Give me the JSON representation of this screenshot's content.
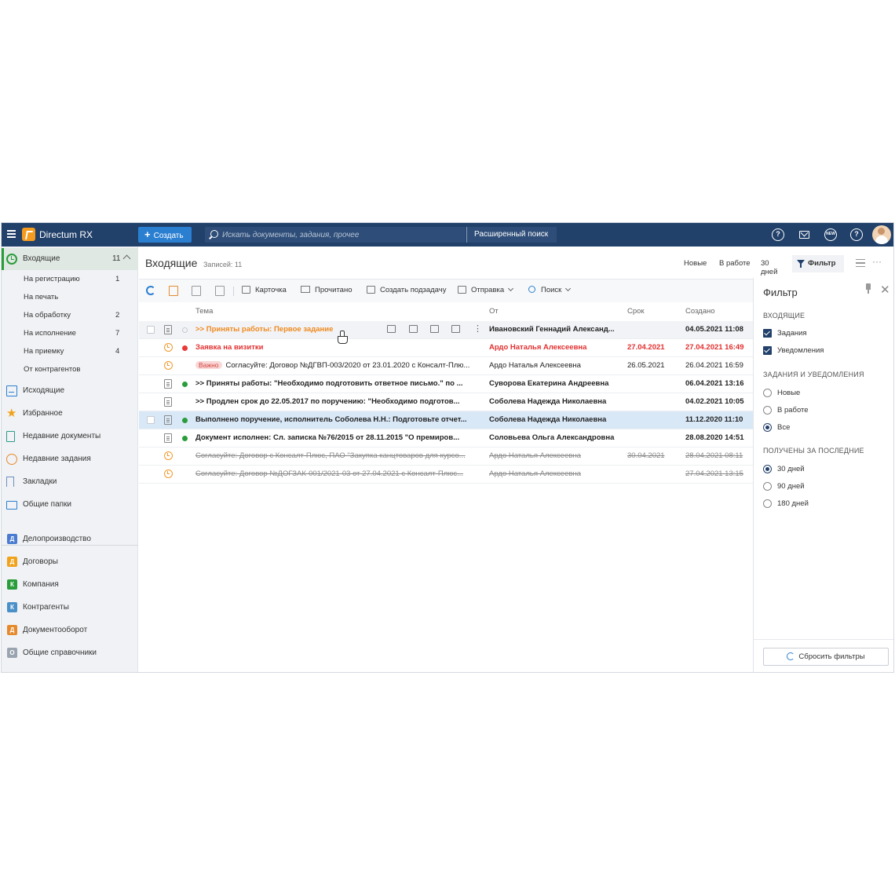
{
  "header": {
    "app_title": "Directum RX",
    "create_label": "Создать",
    "search_placeholder": "Искать документы, задания, прочее",
    "advanced_search": "Расширенный поиск",
    "icons": [
      "support-icon",
      "mail-icon",
      "new-icon",
      "help-icon"
    ],
    "new_badge": "NEW",
    "help_glyph": "?"
  },
  "sidebar": {
    "inbox": {
      "label": "Входящие",
      "count": "11"
    },
    "inbox_sub": [
      {
        "label": "На регистрацию",
        "count": "1"
      },
      {
        "label": "На печать",
        "count": ""
      },
      {
        "label": "На обработку",
        "count": "2"
      },
      {
        "label": "На исполнение",
        "count": "7"
      },
      {
        "label": "На приемку",
        "count": "4"
      },
      {
        "label": "От контрагентов",
        "count": ""
      }
    ],
    "items": [
      {
        "label": "Исходящие"
      },
      {
        "label": "Избранное"
      },
      {
        "label": "Недавние документы"
      },
      {
        "label": "Недавние задания"
      },
      {
        "label": "Закладки"
      },
      {
        "label": "Общие папки"
      }
    ],
    "modules": [
      {
        "label": "Делопроизводство",
        "letter": "Д",
        "color": "#4a7bd0"
      },
      {
        "label": "Договоры",
        "letter": "Д",
        "color": "#f0a21a"
      },
      {
        "label": "Компания",
        "letter": "К",
        "color": "#2a9d3b"
      },
      {
        "label": "Контрагенты",
        "letter": "К",
        "color": "#4a90c8"
      },
      {
        "label": "Документооборот",
        "letter": "Д",
        "color": "#e58a2c"
      },
      {
        "label": "Общие справочники",
        "letter": "О",
        "color": "#9aa4b1"
      }
    ]
  },
  "main": {
    "title": "Входящие",
    "records": "Записей: 11",
    "quick_filters": [
      "Новые",
      "В работе",
      "30 дней"
    ],
    "filter_label": "Фильтр",
    "toolbar": {
      "card": "Карточка",
      "read": "Прочитано",
      "subtask": "Создать подзадачу",
      "send": "Отправка",
      "search": "Поиск"
    },
    "columns": {
      "subject": "Тема",
      "from": "От",
      "due": "Срок",
      "created": "Создано"
    },
    "rows": [
      {
        "subject": ">> Приняты работы: Первое задание",
        "badge": "",
        "from": "Ивановский Геннадий Александ...",
        "due": "",
        "created": "04.05.2021 11:08"
      },
      {
        "subject": "Заявка на визитки",
        "badge": "",
        "from": "Ардо Наталья Алексеевна",
        "due": "27.04.2021",
        "created": "27.04.2021 16:49"
      },
      {
        "subject": "Согласуйте: Договор №ДГВП-003/2020 от 23.01.2020 с Консалт-Плю...",
        "badge": "Важно",
        "from": "Ардо Наталья Алексеевна",
        "due": "26.05.2021",
        "created": "26.04.2021 16:59"
      },
      {
        "subject": ">> Приняты работы: \"Необходимо подготовить ответное письмо.\" по ...",
        "badge": "",
        "from": "Суворова Екатерина Андреевна",
        "due": "",
        "created": "06.04.2021 13:16"
      },
      {
        "subject": ">> Продлен срок до 22.05.2017 по поручению: \"Необходимо подготов...",
        "badge": "",
        "from": "Соболева Надежда Николаевна",
        "due": "",
        "created": "04.02.2021 10:05"
      },
      {
        "subject": "Выполнено поручение, исполнитель Соболева Н.Н.: Подготовьте отчет...",
        "badge": "",
        "from": "Соболева Надежда Николаевна",
        "due": "",
        "created": "11.12.2020 11:10"
      },
      {
        "subject": "Документ исполнен: Сл. записка №76/2015 от 28.11.2015 \"О премиров...",
        "badge": "",
        "from": "Соловьева Ольга Александровна",
        "due": "",
        "created": "28.08.2020 14:51"
      },
      {
        "subject": "Согласуйте: Договор с Консалт-Плюс, ПАО \"Закупка канцтоваров для курсо...",
        "badge": "",
        "from": "Ардо Наталья Алексеевна",
        "due": "30.04.2021",
        "created": "28.04.2021 08:11"
      },
      {
        "subject": "Согласуйте: Договор №ДОГЗАК-001/2021-03 от 27.04.2021 с Консалт-Плюс...",
        "badge": "",
        "from": "Ардо Наталья Алексеевна",
        "due": "",
        "created": "27.04.2021 13:15"
      }
    ]
  },
  "filter": {
    "title": "Фильтр",
    "section_inbox": "ВХОДЯЩИЕ",
    "inbox_opts": [
      "Задания",
      "Уведомления"
    ],
    "section_tasks": "ЗАДАНИЯ И УВЕДОМЛЕНИЯ",
    "tasks_opts": [
      "Новые",
      "В работе",
      "Все"
    ],
    "tasks_selected": "Все",
    "section_period": "ПОЛУЧЕНЫ ЗА ПОСЛЕДНИЕ",
    "period_opts": [
      "30 дней",
      "90 дней",
      "180 дней"
    ],
    "period_selected": "30 дней",
    "reset": "Сбросить фильтры"
  }
}
